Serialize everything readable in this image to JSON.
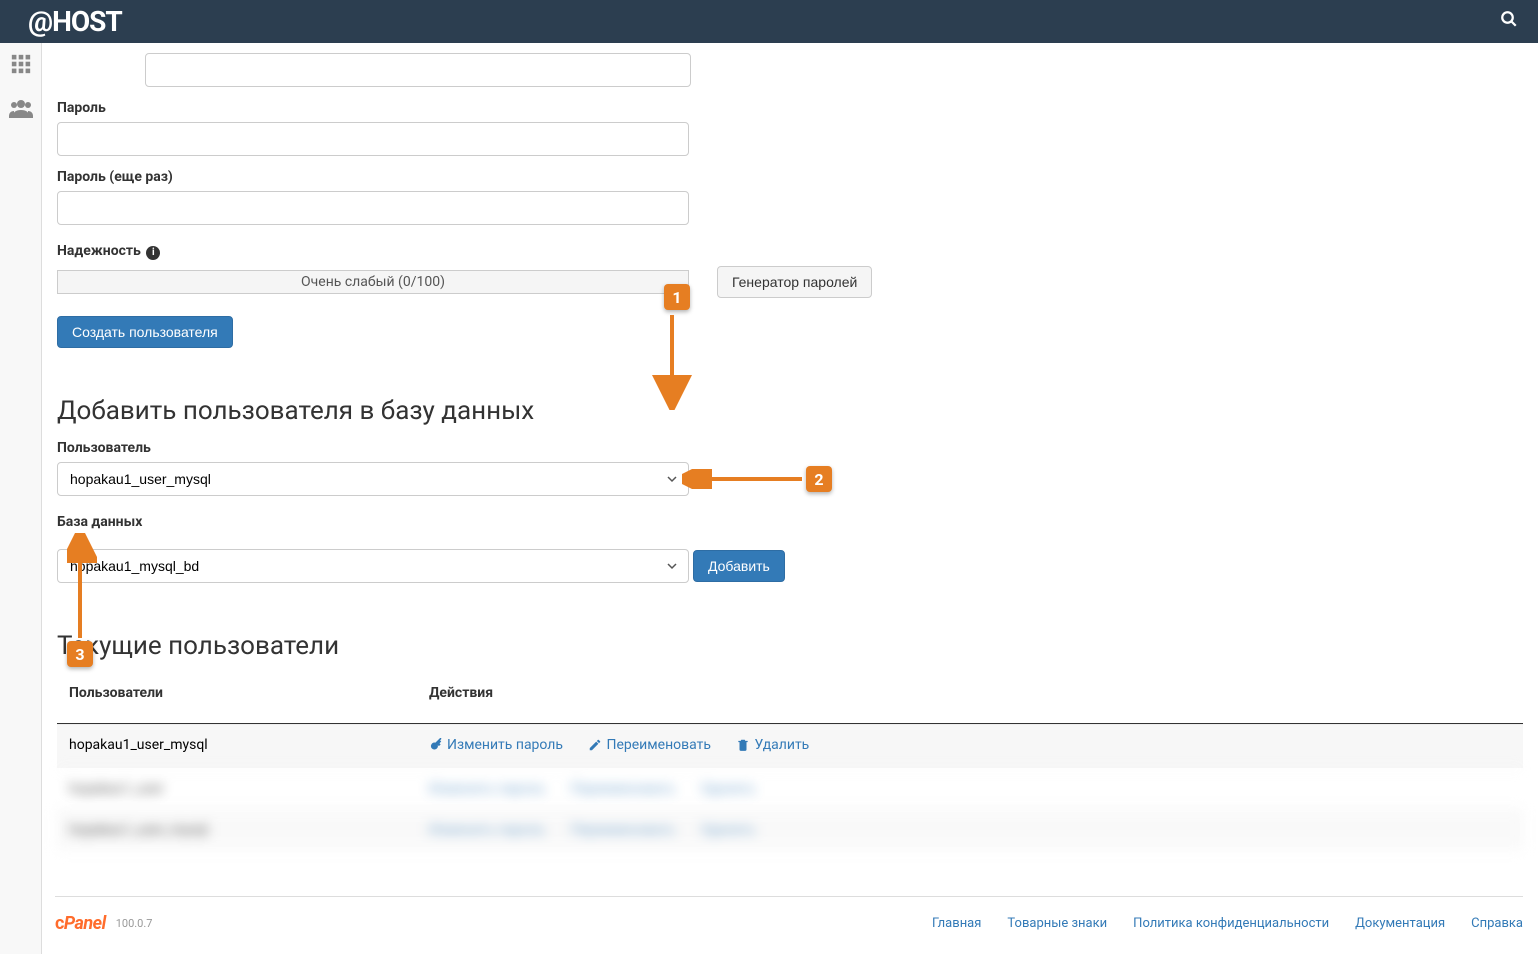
{
  "header": {
    "logo": "@HOST"
  },
  "form": {
    "password_label": "Пароль",
    "password_again_label": "Пароль (еще раз)",
    "strength_label": "Надежность",
    "strength_value": "Очень слабый (0/100)",
    "generator_btn": "Генератор паролей",
    "create_user_btn": "Создать пользователя"
  },
  "add_user_db": {
    "heading": "Добавить пользователя в базу данных",
    "user_label": "Пользователь",
    "user_value": "hopakau1_user_mysql",
    "db_label": "База данных",
    "db_value": "hopakau1_mysql_bd",
    "add_btn": "Добавить"
  },
  "current_users": {
    "heading": "Текущие пользователи",
    "col_users": "Пользователи",
    "col_actions": "Действия",
    "rows": [
      {
        "user": "hopakau1_user_mysql",
        "change_pwd": "Изменить пароль",
        "rename": "Переименовать",
        "delete": "Удалить"
      }
    ],
    "blurred_text_a": "hopakau1_user",
    "blurred_text_b": "hopakau1_user_mysql",
    "blurred_action_a": "Изменить пароль",
    "blurred_action_b": "Переименовать",
    "blurred_action_c": "Удалить"
  },
  "footer": {
    "brand": "cPanel",
    "version": "100.0.7",
    "links": [
      "Главная",
      "Товарные знаки",
      "Политика конфиденциальности",
      "Документация",
      "Справка"
    ]
  },
  "annotations": {
    "one": "1",
    "two": "2",
    "three": "3"
  }
}
